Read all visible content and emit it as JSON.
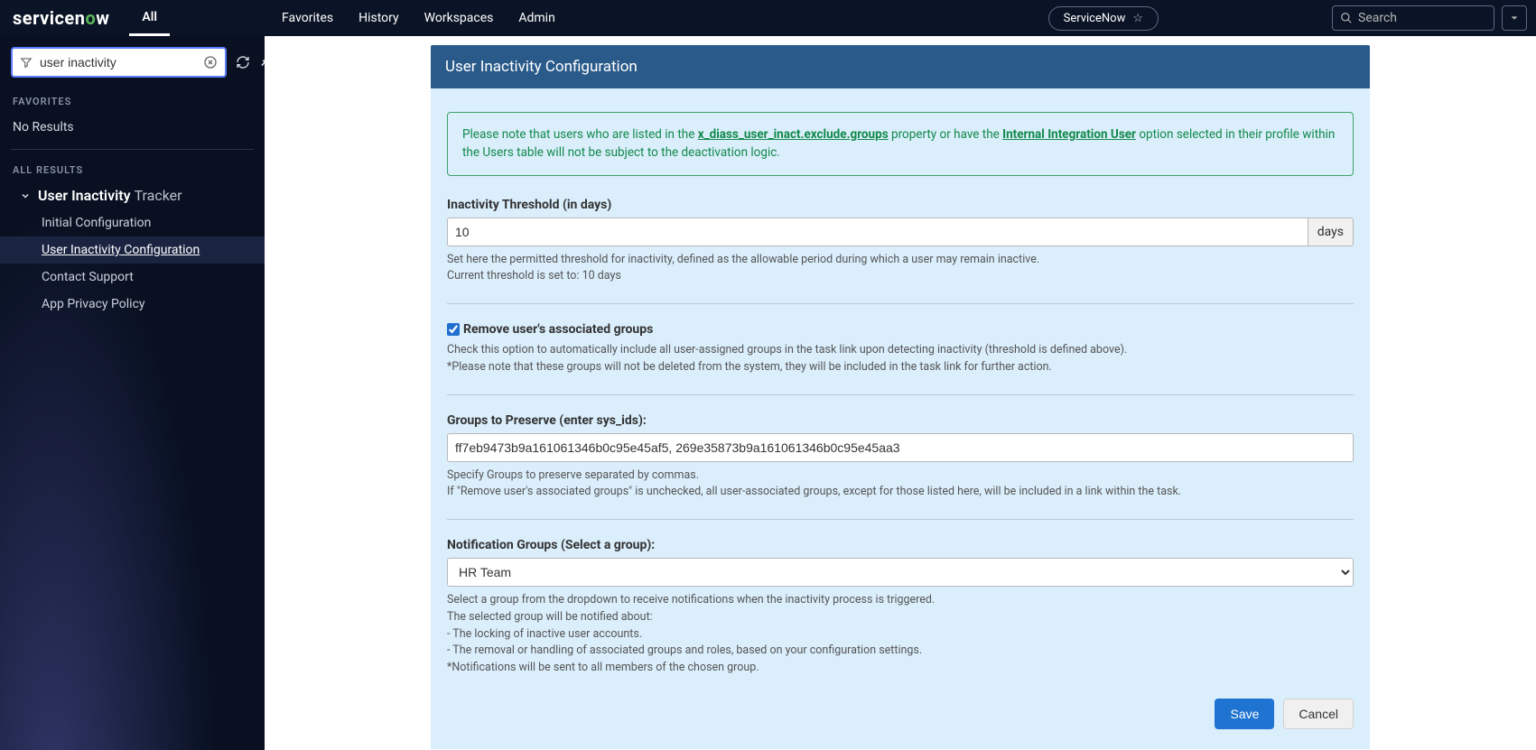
{
  "topnav": {
    "logo": "servicenow",
    "all": "All",
    "favorites": "Favorites",
    "history": "History",
    "workspaces": "Workspaces",
    "admin": "Admin",
    "scope": "ServiceNow",
    "search_placeholder": "Search"
  },
  "sidebar": {
    "filter_value": "user inactivity",
    "favorites_label": "FAVORITES",
    "no_results": "No Results",
    "all_results_label": "ALL RESULTS",
    "parent_bold": "User Inactivity",
    "parent_light": "Tracker",
    "items": [
      {
        "label": "Initial Configuration"
      },
      {
        "label_bold": "User Inactivity",
        "label_rest": " Configuration"
      },
      {
        "label": "Contact Support"
      },
      {
        "label": "App Privacy Policy"
      }
    ]
  },
  "panel": {
    "title": "User Inactivity Configuration",
    "info_pre": "Please note that users who are listed in the ",
    "info_prop": "x_diass_user_inact.exclude.groups",
    "info_mid": " property or have the ",
    "info_opt": "Internal Integration User",
    "info_post": " option selected in their profile within the Users table will not be subject to the deactivation logic.",
    "threshold": {
      "label": "Inactivity Threshold (in days)",
      "value": "10",
      "suffix": "days",
      "help1": "Set here the permitted threshold for inactivity, defined as the allowable period during which a user may remain inactive.",
      "help2": "Current threshold is set to:  10  days"
    },
    "remove_groups": {
      "label": "Remove user's associated groups",
      "help1": "Check this option to automatically include all user-assigned groups in the task link upon detecting inactivity (threshold is defined above).",
      "help2": "*Please note that these groups will not be deleted from the system, they will be included in the task link for further action."
    },
    "preserve": {
      "label": "Groups to Preserve (enter sys_ids):",
      "value": "ff7eb9473b9a161061346b0c95e45af5, 269e35873b9a161061346b0c95e45aa3",
      "help1": "Specify Groups to preserve separated by commas.",
      "help2": "If \"Remove user's associated groups\" is unchecked, all user-associated groups, except for those listed here, will be included in a link within the task."
    },
    "notify": {
      "label": "Notification Groups (Select a group):",
      "value": "HR Team",
      "help1": "Select a group from the dropdown to receive notifications when the inactivity process is triggered.",
      "help2": "The selected group will be notified about:",
      "help3": "- The locking of inactive user accounts.",
      "help4": "- The removal or handling of associated groups and roles, based on your configuration settings.",
      "help5": "*Notifications will be sent to all members of the chosen group."
    },
    "save": "Save",
    "cancel": "Cancel"
  }
}
